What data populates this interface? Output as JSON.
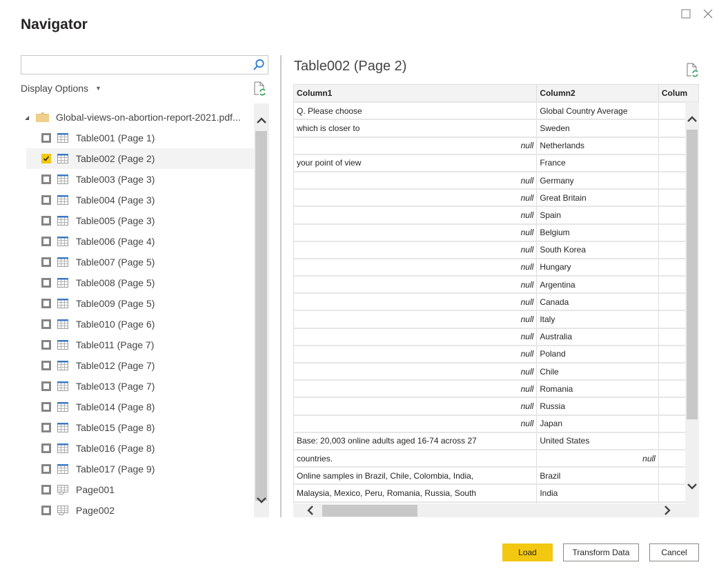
{
  "window": {
    "title": "Navigator",
    "maximize_icon": "maximize-icon",
    "close_icon": "close-icon"
  },
  "search": {
    "value": "",
    "placeholder": "",
    "icon": "search-icon"
  },
  "display_options": {
    "label": "Display Options",
    "icon": "chevron-down-icon"
  },
  "tree": {
    "root": {
      "label": "Global-views-on-abortion-report-2021.pdf...",
      "expanded": true,
      "icon": "folder-icon"
    },
    "items": [
      {
        "label": "Table001 (Page 1)",
        "type": "table",
        "checked": false
      },
      {
        "label": "Table002 (Page 2)",
        "type": "table",
        "checked": true
      },
      {
        "label": "Table003 (Page 3)",
        "type": "table",
        "checked": false
      },
      {
        "label": "Table004 (Page 3)",
        "type": "table",
        "checked": false
      },
      {
        "label": "Table005 (Page 3)",
        "type": "table",
        "checked": false
      },
      {
        "label": "Table006 (Page 4)",
        "type": "table",
        "checked": false
      },
      {
        "label": "Table007 (Page 5)",
        "type": "table",
        "checked": false
      },
      {
        "label": "Table008 (Page 5)",
        "type": "table",
        "checked": false
      },
      {
        "label": "Table009 (Page 5)",
        "type": "table",
        "checked": false
      },
      {
        "label": "Table010 (Page 6)",
        "type": "table",
        "checked": false
      },
      {
        "label": "Table011 (Page 7)",
        "type": "table",
        "checked": false
      },
      {
        "label": "Table012 (Page 7)",
        "type": "table",
        "checked": false
      },
      {
        "label": "Table013 (Page 7)",
        "type": "table",
        "checked": false
      },
      {
        "label": "Table014 (Page 8)",
        "type": "table",
        "checked": false
      },
      {
        "label": "Table015 (Page 8)",
        "type": "table",
        "checked": false
      },
      {
        "label": "Table016 (Page 8)",
        "type": "table",
        "checked": false
      },
      {
        "label": "Table017 (Page 9)",
        "type": "table",
        "checked": false
      },
      {
        "label": "Page001",
        "type": "page",
        "checked": false
      },
      {
        "label": "Page002",
        "type": "page",
        "checked": false
      }
    ]
  },
  "preview": {
    "title": "Table002 (Page 2)",
    "columns": [
      "Column1",
      "Column2",
      "Colum"
    ],
    "null_text": "null",
    "rows": [
      [
        "Q. Please choose",
        "Global Country Average",
        ""
      ],
      [
        "which is closer to",
        "Sweden",
        ""
      ],
      [
        null,
        "Netherlands",
        ""
      ],
      [
        "your point of view",
        "France",
        ""
      ],
      [
        null,
        "Germany",
        ""
      ],
      [
        null,
        "Great Britain",
        ""
      ],
      [
        null,
        "Spain",
        ""
      ],
      [
        null,
        "Belgium",
        ""
      ],
      [
        null,
        "South Korea",
        ""
      ],
      [
        null,
        "Hungary",
        ""
      ],
      [
        null,
        "Argentina",
        ""
      ],
      [
        null,
        "Canada",
        ""
      ],
      [
        null,
        "Italy",
        ""
      ],
      [
        null,
        "Australia",
        ""
      ],
      [
        null,
        "Poland",
        ""
      ],
      [
        null,
        "Chile",
        ""
      ],
      [
        null,
        "Romania",
        ""
      ],
      [
        null,
        "Russia",
        ""
      ],
      [
        null,
        "Japan",
        ""
      ],
      [
        "Base: 20,003 online adults aged 16-74 across 27",
        "United States",
        ""
      ],
      [
        "countries.",
        null,
        ""
      ],
      [
        "Online samples in Brazil, Chile, Colombia, India,",
        "Brazil",
        ""
      ],
      [
        "Malaysia, Mexico, Peru, Romania, Russia, South",
        "India",
        ""
      ],
      [
        "",
        "",
        ""
      ]
    ]
  },
  "footer": {
    "load_label": "Load",
    "transform_label": "Transform Data",
    "cancel_label": "Cancel"
  },
  "colors": {
    "accent": "#f2c811",
    "border": "#c8c8c8",
    "header_bg": "#f3f3f3"
  }
}
